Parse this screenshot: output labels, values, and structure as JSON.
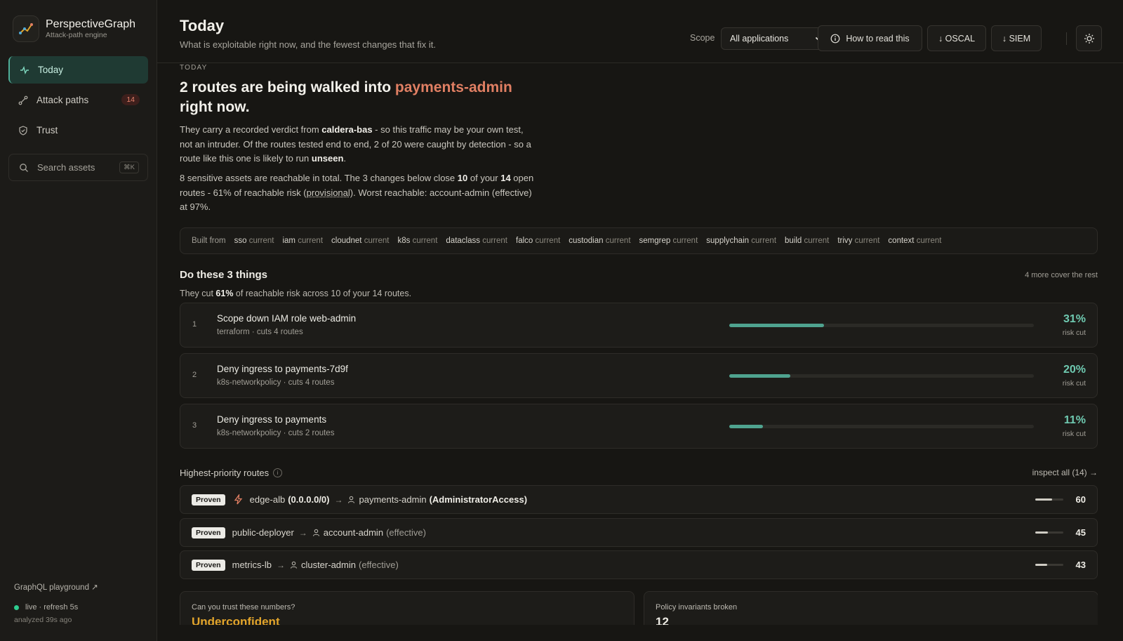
{
  "brand": {
    "name": "PerspectiveGraph",
    "subtitle": "Attack-path engine"
  },
  "sidebar": {
    "items": [
      {
        "label": "Today",
        "icon": "pulse-icon"
      },
      {
        "label": "Attack paths",
        "icon": "path-icon",
        "badge": "14"
      },
      {
        "label": "Trust",
        "icon": "shield-icon"
      }
    ],
    "search": {
      "placeholder": "Search assets",
      "shortcut": "⌘K"
    },
    "footer": {
      "playground": "GraphQL playground ↗",
      "live": "live · refresh 5s",
      "analyzed": "analyzed 39s ago"
    }
  },
  "header": {
    "title": "Today",
    "subtitle": "What is exploitable right now, and the fewest changes that fix it.",
    "scope_label": "Scope",
    "scope_value": "All applications",
    "how_to_read": "How to read this",
    "oscal": "↓ OSCAL",
    "siem": "↓ SIEM"
  },
  "today": {
    "kicker": "TODAY",
    "headline_pre": "2 routes are being walked into ",
    "headline_target": "payments-admin",
    "headline_post": " right now.",
    "p1": {
      "a": "They carry a recorded verdict from ",
      "b": "caldera-bas",
      "c": " - so this traffic may be your own test, not an intruder. Of the routes tested end to end, 2 of 20 were caught by detection - so a route like this one is likely to run ",
      "d": "unseen",
      "e": "."
    },
    "p2": {
      "a": "8 sensitive assets are reachable in total. The 3 changes below close ",
      "b": "10",
      "c": " of your ",
      "d": "14",
      "e": " open routes - 61% of reachable risk (",
      "f": "provisional",
      "g": "). Worst reachable: account-admin (effective) at 97%."
    }
  },
  "built_from": {
    "label": "Built from",
    "sources": [
      {
        "name": "sso",
        "status": "current"
      },
      {
        "name": "iam",
        "status": "current"
      },
      {
        "name": "cloudnet",
        "status": "current"
      },
      {
        "name": "k8s",
        "status": "current"
      },
      {
        "name": "dataclass",
        "status": "current"
      },
      {
        "name": "falco",
        "status": "current"
      },
      {
        "name": "custodian",
        "status": "current"
      },
      {
        "name": "semgrep",
        "status": "current"
      },
      {
        "name": "supplychain",
        "status": "current"
      },
      {
        "name": "build",
        "status": "current"
      },
      {
        "name": "trivy",
        "status": "current"
      },
      {
        "name": "context",
        "status": "current"
      }
    ]
  },
  "actions_section": {
    "title": "Do these 3 things",
    "more": "4 more cover the rest",
    "sub_pre": "They cut ",
    "sub_pct": "61%",
    "sub_post": " of reachable risk across 10 of your 14 routes.",
    "risk_label": "risk cut",
    "items": [
      {
        "n": "1",
        "title": "Scope down IAM role web-admin",
        "meta": "terraform · cuts 4 routes",
        "pct": "31%",
        "fraction": 0.31
      },
      {
        "n": "2",
        "title": "Deny ingress to payments-7d9f",
        "meta": "k8s-networkpolicy · cuts 4 routes",
        "pct": "20%",
        "fraction": 0.2
      },
      {
        "n": "3",
        "title": "Deny ingress to payments",
        "meta": "k8s-networkpolicy · cuts 2 routes",
        "pct": "11%",
        "fraction": 0.11
      }
    ]
  },
  "routes_section": {
    "title": "Highest-priority routes",
    "info": "i",
    "inspect": "inspect all (14) →",
    "items": [
      {
        "badge": "Proven",
        "source": "edge-alb",
        "source_detail": "(0.0.0.0/0)",
        "target": "payments-admin",
        "target_detail": "(AdministratorAccess)",
        "score": "60",
        "score_fraction": 0.6,
        "bolt": true
      },
      {
        "badge": "Proven",
        "source": "public-deployer",
        "target": "account-admin",
        "target_detail": "(effective)",
        "score": "45",
        "score_fraction": 0.45
      },
      {
        "badge": "Proven",
        "source": "metrics-lb",
        "target": "cluster-admin",
        "target_detail": "(effective)",
        "score": "43",
        "score_fraction": 0.43
      }
    ]
  },
  "cards": {
    "trust_label": "Can you trust these numbers?",
    "trust_value": "Underconfident",
    "policy_label": "Policy invariants broken",
    "policy_value": "12"
  },
  "colors": {
    "accent": "#4fa38f",
    "danger": "#e07f63",
    "warning": "#e3a52b"
  }
}
